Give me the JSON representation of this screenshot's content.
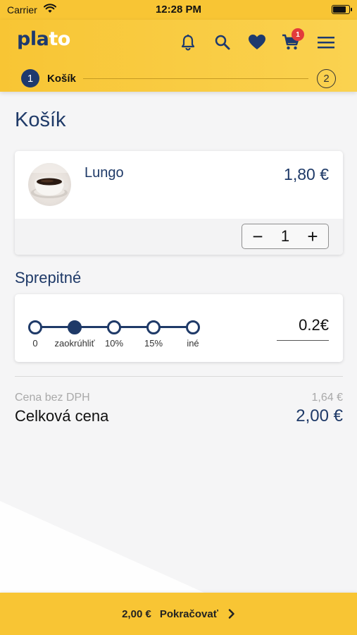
{
  "status": {
    "carrier": "Carrier",
    "time": "12:28 PM",
    "battery_level": 0.92
  },
  "header": {
    "logo_part1": "pla",
    "logo_part2": "to",
    "cart_count": "1",
    "icons": [
      "bell-icon",
      "search-icon",
      "heart-icon",
      "cart-icon",
      "menu-icon"
    ],
    "colors": {
      "brand_yellow": "#f8c534",
      "brand_navy": "#1e3a6e",
      "badge_red": "#e23b3b"
    }
  },
  "steps": [
    {
      "number": "1",
      "label": "Košík",
      "active": true
    },
    {
      "number": "2",
      "label": "",
      "active": false
    }
  ],
  "page_title": "Košík",
  "cart": {
    "items": [
      {
        "name": "Lungo",
        "price": "1,80 €",
        "quantity": "1",
        "minus": "−",
        "plus": "+"
      }
    ]
  },
  "tips": {
    "title": "Sprepitné",
    "options": [
      "0",
      "zaokrúhliť",
      "10%",
      "15%",
      "iné"
    ],
    "selected_index": 1,
    "amount": "0.2€"
  },
  "summary": {
    "net_label": "Cena bez DPH",
    "net_value": "1,64 €",
    "total_label": "Celková cena",
    "total_value": "2,00 €"
  },
  "footer": {
    "amount": "2,00 €",
    "continue_label": "Pokračovať"
  }
}
